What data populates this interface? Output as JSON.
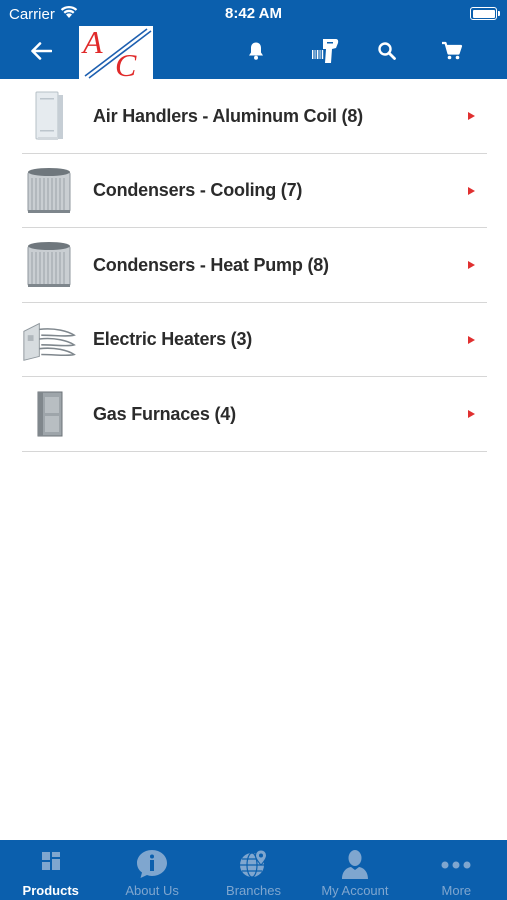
{
  "status": {
    "carrier": "Carrier",
    "time": "8:42 AM"
  },
  "header": {
    "logo_text": "A/C",
    "icons": [
      "back-arrow-icon",
      "bell-icon",
      "barcode-scanner-icon",
      "search-icon",
      "cart-icon"
    ]
  },
  "categories": [
    {
      "label": "Air Handlers - Aluminum Coil (8)",
      "thumb": "air-handler"
    },
    {
      "label": "Condensers - Cooling (7)",
      "thumb": "condenser"
    },
    {
      "label": "Condensers - Heat Pump (8)",
      "thumb": "condenser"
    },
    {
      "label": "Electric Heaters (3)",
      "thumb": "electric-heater"
    },
    {
      "label": "Gas Furnaces (4)",
      "thumb": "gas-furnace"
    }
  ],
  "tabs": [
    {
      "label": "Products",
      "icon": "products-grid-icon",
      "active": true
    },
    {
      "label": "About Us",
      "icon": "info-bubble-icon",
      "active": false
    },
    {
      "label": "Branches",
      "icon": "globe-pin-icon",
      "active": false
    },
    {
      "label": "My Account",
      "icon": "user-icon",
      "active": false
    },
    {
      "label": "More",
      "icon": "more-dots-icon",
      "active": false
    }
  ],
  "colors": {
    "brand_blue": "#0b5fad",
    "accent_red": "#e03030",
    "tab_inactive": "#7fa6cf"
  }
}
